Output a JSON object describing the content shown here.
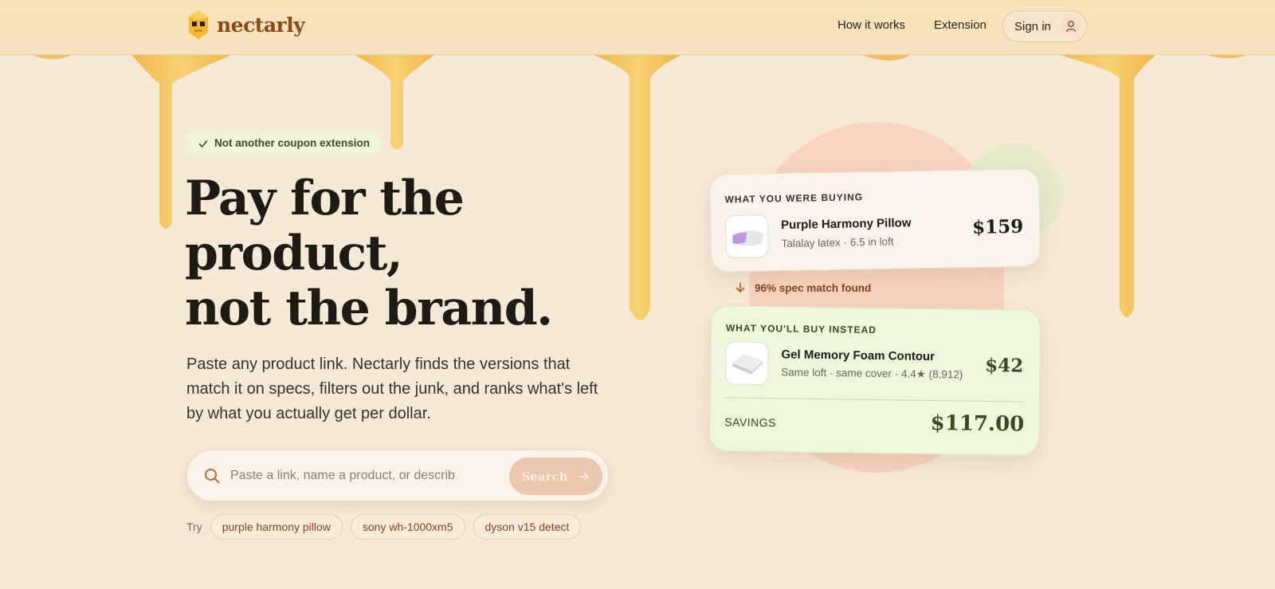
{
  "header": {
    "brand": "nectarly",
    "nav": [
      {
        "label": "How it works"
      },
      {
        "label": "Extension"
      }
    ],
    "signin_label": "Sign in"
  },
  "hero": {
    "badge": "Not another coupon extension",
    "headline": [
      "Pay for the",
      "product,",
      "not the brand."
    ],
    "subtext": "Paste any product link. Nectarly finds the versions that match it on specs, filters out the junk, and ranks what's left by what you actually get per dollar.",
    "search": {
      "placeholder": "Paste a link, name a product, or describe what y",
      "button_label": "Search"
    },
    "try_label": "Try",
    "suggestions": [
      "purple harmony pillow",
      "sony wh-1000xm5",
      "dyson v15 detect"
    ]
  },
  "comparison": {
    "current": {
      "label": "WHAT YOU WERE BUYING",
      "name": "Purple Harmony Pillow",
      "meta": "Talalay latex · 6.5 in loft",
      "price": "$159"
    },
    "match_text": "96% spec match found",
    "alternative": {
      "label": "WHAT YOU'LL BUY INSTEAD",
      "name": "Gel Memory Foam Contour",
      "meta": "Same loft · same cover · 4.4★ (8,912)",
      "price": "$42"
    },
    "savings_label": "SAVINGS",
    "savings_value": "$117.00"
  },
  "colors": {
    "background": "#f6ead7",
    "brand": "#8a4a18",
    "honey": "#f3c15c",
    "accent_green": "#eef7dc",
    "accent_peach": "#f8d4c0"
  }
}
